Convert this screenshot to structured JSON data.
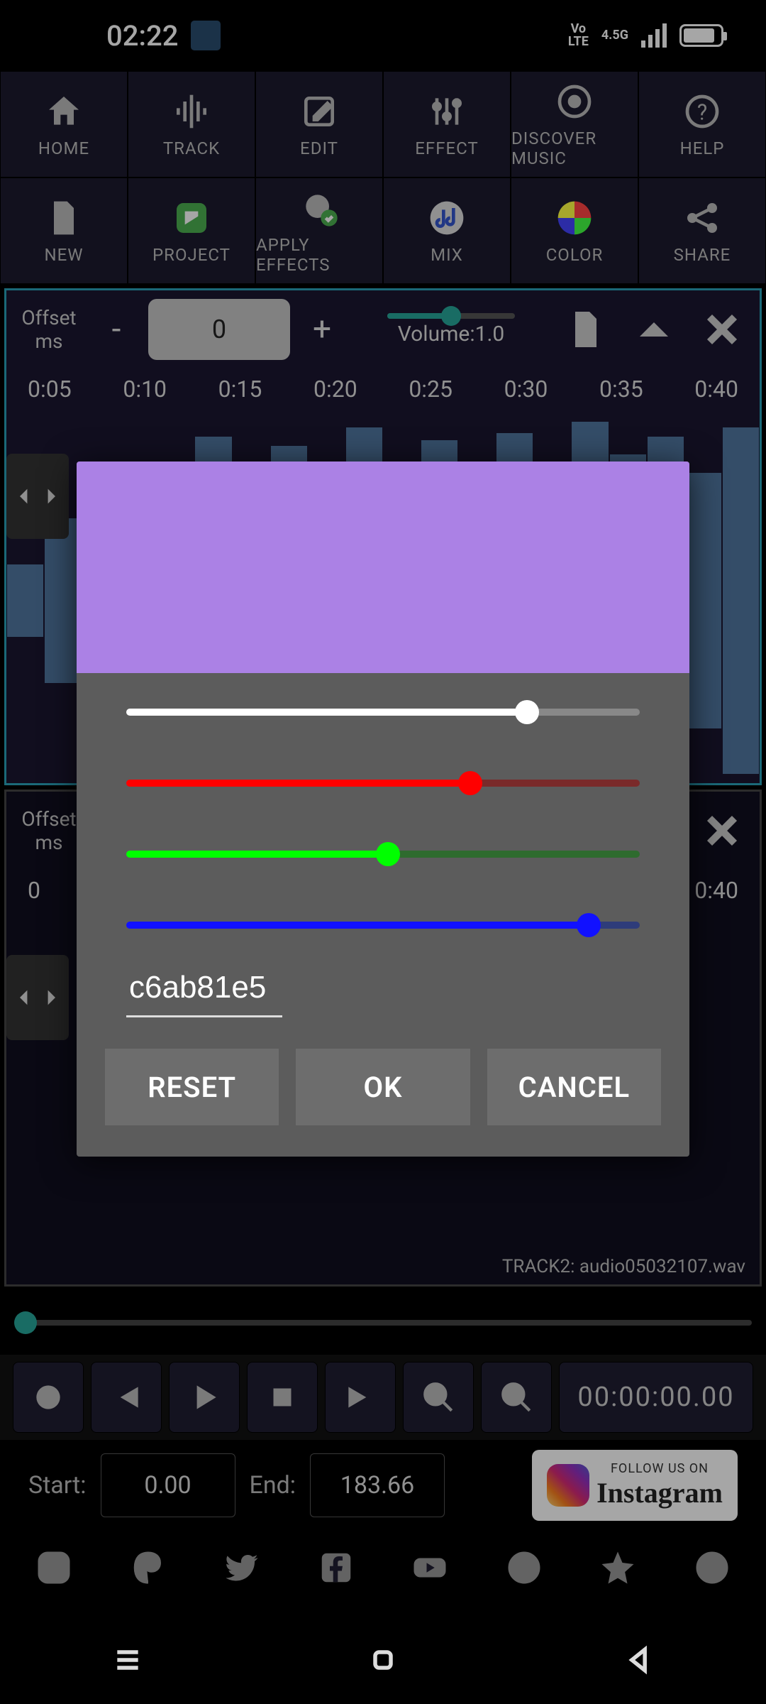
{
  "status": {
    "time": "02:22",
    "volte": "Vo\nLTE",
    "net": "4.5G"
  },
  "toolbar1": {
    "home": "HOME",
    "track": "TRACK",
    "edit": "EDIT",
    "effect": "EFFECT",
    "discover": "DISCOVER MUSIC",
    "help": "HELP"
  },
  "toolbar2": {
    "new": "NEW",
    "project": "PROJECT",
    "apply": "APPLY EFFECTS",
    "mix": "MIX",
    "color": "COLOR",
    "share": "SHARE"
  },
  "track1": {
    "offset_label": "Offset\nms",
    "offset_value": "0",
    "volume_label": "Volume:1.0",
    "ticks": [
      "0:05",
      "0:10",
      "0:15",
      "0:20",
      "0:25",
      "0:30",
      "0:35",
      "0:40"
    ]
  },
  "track2": {
    "offset_label": "Offset\nms",
    "tick_left": "0",
    "tick_right": "0:40",
    "name": "TRACK2: audio05032107.wav"
  },
  "transport": {
    "time": "00:00:00.00"
  },
  "range": {
    "start_label": "Start:",
    "start": "0.00",
    "end_label": "End:",
    "end": "183.66"
  },
  "insta": {
    "follow": "FOLLOW US ON",
    "name": "Instagram"
  },
  "color_dialog": {
    "preview_color": "#ab81e5",
    "alpha_pct": 78,
    "red_pct": 67,
    "green_pct": 51,
    "blue_pct": 90,
    "hex": "c6ab81e5",
    "reset": "RESET",
    "ok": "OK",
    "cancel": "CANCEL"
  }
}
